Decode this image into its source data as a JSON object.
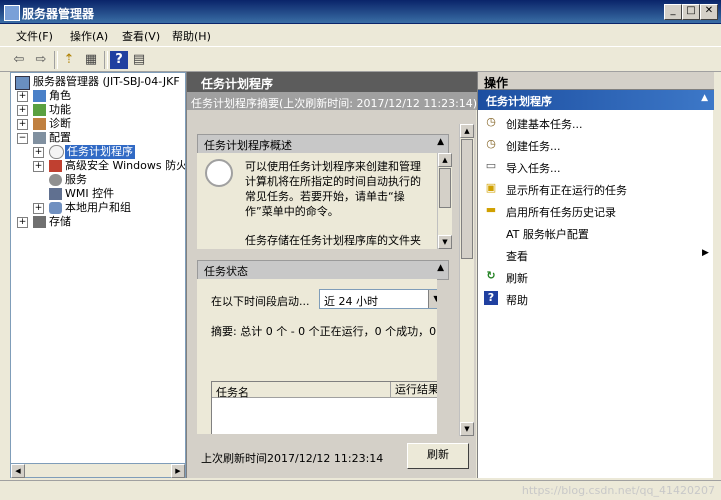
{
  "window": {
    "title": "服务器管理器",
    "min": "_",
    "max": "□",
    "close": "✕"
  },
  "menu": [
    {
      "label": "文件(F)"
    },
    {
      "label": "操作(A)"
    },
    {
      "label": "查看(V)"
    },
    {
      "label": "帮助(H)"
    }
  ],
  "toolbar": {
    "back": "⇦",
    "forward": "⇨",
    "up": "⇡",
    "view": "▦",
    "help": "?",
    "panel": "▤"
  },
  "tree": {
    "root": "服务器管理器 (JIT-SBJ-04-JKF",
    "items": [
      {
        "label": "角色",
        "exp": "+"
      },
      {
        "label": "功能",
        "exp": "+"
      },
      {
        "label": "诊断",
        "exp": "+"
      },
      {
        "label": "配置",
        "exp": "−"
      },
      {
        "label": "任务计划程序",
        "exp": "+"
      },
      {
        "label": "高级安全 Windows 防火墙",
        "exp": "+"
      },
      {
        "label": "服务",
        "exp": ""
      },
      {
        "label": "WMI 控件",
        "exp": ""
      },
      {
        "label": "本地用户和组",
        "exp": "+"
      },
      {
        "label": "存储",
        "exp": "+"
      }
    ]
  },
  "center": {
    "header": "任务计划程序",
    "subheader": "任务计划程序摘要(上次刷新时间: 2017/12/12 11:23:14)",
    "overview": {
      "title": "任务计划程序概述",
      "text": "可以使用任务计划程序来创建和管理计算机将在所指定的时间自动执行的常见任务。若要开始，请单击“操作”菜单中的命令。",
      "text2": "任务存储在任务计划程序库的文件夹"
    },
    "status": {
      "title": "任务状态",
      "period_label": "在以下时间段启动...",
      "period_value": "近 24 小时",
      "summary": "摘要: 总计 0 个 - 0 个正在运行，0 个成功，0 ...",
      "col_name": "任务名",
      "col_result": "运行结果"
    },
    "footer_time": "上次刷新时间2017/12/12 11:23:14",
    "refresh_button": "刷新"
  },
  "actions": {
    "header": "操作",
    "subheader": "任务计划程序",
    "items": [
      {
        "label": "创建基本任务...",
        "icon": "◷"
      },
      {
        "label": "创建任务...",
        "icon": "◷"
      },
      {
        "label": "导入任务...",
        "icon": "▭"
      },
      {
        "label": "显示所有正在运行的任务",
        "icon": "▣"
      },
      {
        "label": "启用所有任务历史记录",
        "icon": "▬"
      },
      {
        "label": "AT 服务帐户配置",
        "icon": ""
      },
      {
        "label": "查看",
        "icon": ""
      },
      {
        "label": "刷新",
        "icon": "↻"
      },
      {
        "label": "帮助",
        "icon": "?"
      }
    ]
  },
  "watermark": "https://blog.csdn.net/qq_41420207"
}
